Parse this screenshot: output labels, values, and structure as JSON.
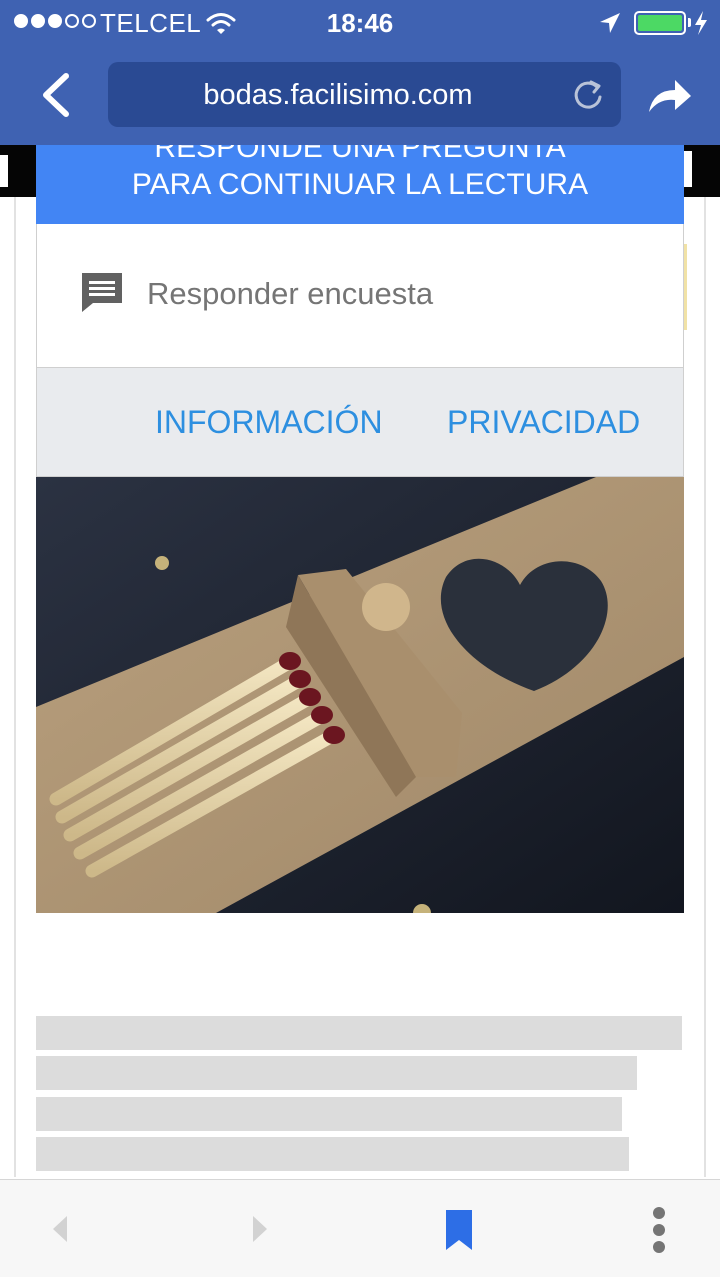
{
  "status_bar": {
    "carrier": "TELCEL",
    "time": "18:46",
    "signal_bars": 3,
    "signal_total": 5,
    "battery_level": 1.0,
    "battery_color": "#4cd964",
    "icons": [
      "wifi-icon",
      "location-arrow-icon",
      "battery-icon",
      "charging-bolt-icon"
    ]
  },
  "browser": {
    "url": "bodas.facilisimo.com",
    "bar_color": "#3f62b2",
    "icons": [
      "back-chevron-icon",
      "reload-icon",
      "share-icon"
    ]
  },
  "banner": {
    "line1": "RESPONDE UNA PREGUNTA",
    "line2": "PARA CONTINUAR LA LECTURA",
    "color": "#4285f4"
  },
  "survey": {
    "icon": "comment-icon",
    "label": "Responder encuesta"
  },
  "links": {
    "info": "INFORMACIÓN",
    "privacy": "PRIVACIDAD",
    "color": "#2d8fe0"
  },
  "toolbar": {
    "icons": [
      "back-arrow-icon",
      "forward-arrow-icon",
      "bookmark-icon",
      "more-vertical-icon"
    ],
    "accent": "#2d6ee6"
  }
}
